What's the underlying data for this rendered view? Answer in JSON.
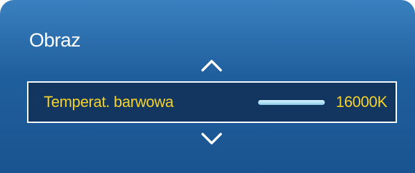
{
  "panel": {
    "title": "Obraz"
  },
  "setting": {
    "label": "Temperat. barwowa",
    "value": "16000K",
    "level": 1.0
  },
  "icons": {
    "up": "chevron-up-icon",
    "down": "chevron-down-icon"
  },
  "colors": {
    "panel_bg": "#2a6aa8",
    "highlight_bg": "#12365f",
    "highlight_text": "#f7d328",
    "title_text": "#ffffff"
  }
}
